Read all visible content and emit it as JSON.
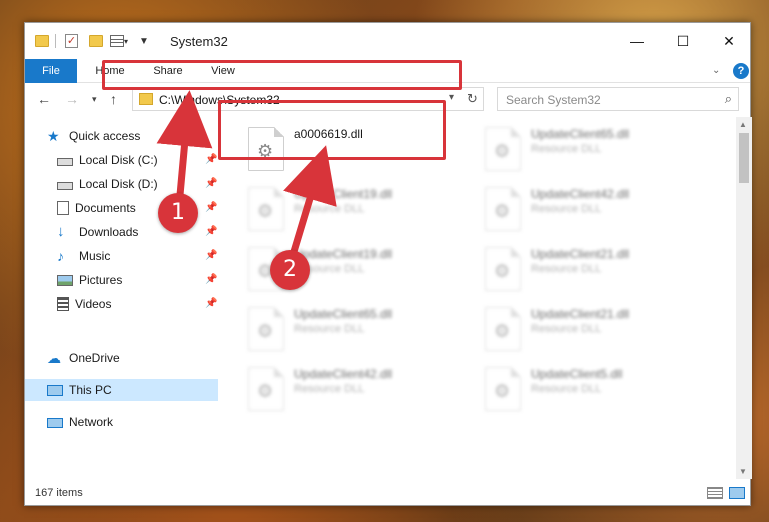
{
  "window": {
    "title": "System32",
    "controls": {
      "minimize": "—",
      "maximize": "☐",
      "close": "✕"
    }
  },
  "ribbon": {
    "tabs": [
      "File",
      "Home",
      "Share",
      "View"
    ],
    "help": "?"
  },
  "navbar": {
    "address": "C:\\Windows\\System32",
    "search_placeholder": "Search System32"
  },
  "sidebar": {
    "items": [
      {
        "label": "Quick access",
        "icon": "star-icon"
      },
      {
        "label": "Local Disk (C:)",
        "icon": "drive-icon",
        "pinned": true
      },
      {
        "label": "Local Disk (D:)",
        "icon": "drive-icon",
        "pinned": true
      },
      {
        "label": "Documents",
        "icon": "documents-icon",
        "pinned": true
      },
      {
        "label": "Downloads",
        "icon": "download-icon",
        "pinned": true
      },
      {
        "label": "Music",
        "icon": "music-icon",
        "pinned": true
      },
      {
        "label": "Pictures",
        "icon": "pictures-icon",
        "pinned": true
      },
      {
        "label": "Videos",
        "icon": "videos-icon",
        "pinned": true
      },
      {
        "label": "OneDrive",
        "icon": "cloud-icon"
      },
      {
        "label": "This PC",
        "icon": "computer-icon",
        "selected": true
      },
      {
        "label": "Network",
        "icon": "network-icon"
      }
    ]
  },
  "files": [
    {
      "name": "a0006619.dll",
      "type": "",
      "blurred": false
    },
    {
      "name": "UpdateClient65.dll",
      "type": "Resource DLL",
      "blurred": true
    },
    {
      "name": "UpdateClient19.dll",
      "type": "Resource DLL",
      "blurred": true
    },
    {
      "name": "UpdateClient42.dll",
      "type": "Resource DLL",
      "blurred": true
    },
    {
      "name": "UpdateClient19.dll",
      "type": "Resource DLL",
      "blurred": true
    },
    {
      "name": "UpdateClient21.dll",
      "type": "Resource DLL",
      "blurred": true
    },
    {
      "name": "UpdateClient65.dll",
      "type": "Resource DLL",
      "blurred": true
    },
    {
      "name": "UpdateClient21.dll",
      "type": "Resource DLL",
      "blurred": true
    },
    {
      "name": "UpdateClient42.dll",
      "type": "Resource DLL",
      "blurred": true
    },
    {
      "name": "UpdateClient5.dll",
      "type": "Resource DLL",
      "blurred": true
    }
  ],
  "status": {
    "count": "167 items"
  },
  "callouts": [
    "1",
    "2"
  ],
  "colors": {
    "accent": "#1979ca",
    "highlight": "#d8343a",
    "selected": "#cce8ff"
  }
}
